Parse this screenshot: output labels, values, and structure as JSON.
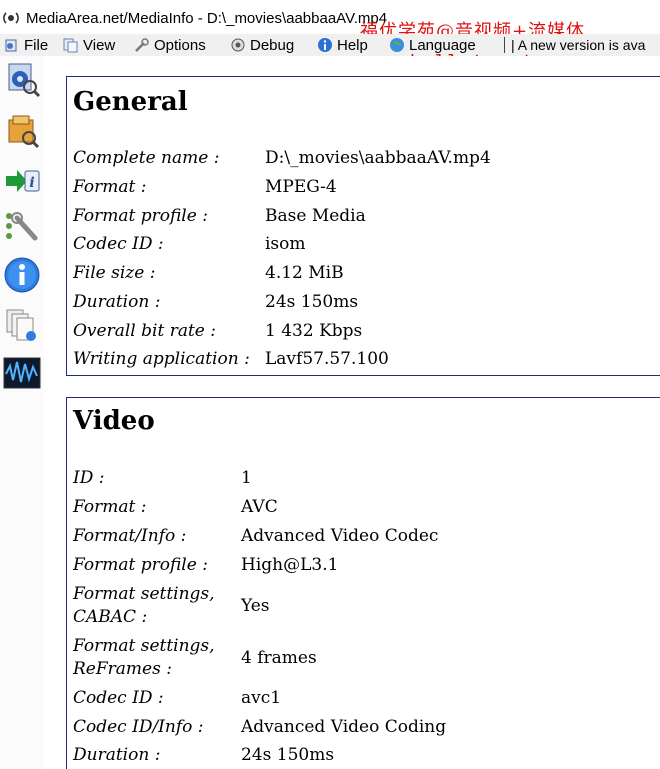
{
  "window": {
    "title": "MediaArea.net/MediaInfo - D:\\_movies\\aabbaaAV.mp4"
  },
  "menu": {
    "file": "File",
    "view": "View",
    "options": "Options",
    "debug": "Debug",
    "help": "Help",
    "language": "Language",
    "notice": "| A new version is ava"
  },
  "watermark": {
    "chinese": "福优学苑@音视频+流媒体",
    "url": "www.hellotongtong.com"
  },
  "sidebar": {
    "icons": [
      "easy-view-icon",
      "sheet-view-icon",
      "export-icon",
      "preferences-icon",
      "about-icon",
      "file-list-icon",
      "waveform-icon"
    ]
  },
  "general": {
    "heading": "General",
    "rows": [
      {
        "label": "Complete name :",
        "value": "D:\\_movies\\aabbaaAV.mp4"
      },
      {
        "label": "Format :",
        "value": "MPEG-4"
      },
      {
        "label": "Format profile :",
        "value": "Base Media"
      },
      {
        "label": "Codec ID :",
        "value": "isom"
      },
      {
        "label": "File size :",
        "value": "4.12 MiB"
      },
      {
        "label": "Duration :",
        "value": "24s 150ms"
      },
      {
        "label": "Overall bit rate :",
        "value": "1 432 Kbps"
      },
      {
        "label": "Writing application :",
        "value": "Lavf57.57.100"
      }
    ]
  },
  "video": {
    "heading": "Video",
    "rows": [
      {
        "label": "ID :",
        "value": "1"
      },
      {
        "label": "Format :",
        "value": "AVC"
      },
      {
        "label": "Format/Info :",
        "value": "Advanced Video Codec"
      },
      {
        "label": "Format profile :",
        "value": "High@L3.1"
      },
      {
        "label_line1": "Format settings,",
        "label_line2": "CABAC :",
        "value": "Yes"
      },
      {
        "label_line1": "Format settings,",
        "label_line2": "ReFrames :",
        "value": "4 frames"
      },
      {
        "label": "Codec ID :",
        "value": "avc1"
      },
      {
        "label": "Codec ID/Info :",
        "value": "Advanced Video Coding"
      },
      {
        "label": "Duration :",
        "value": "24s 150ms"
      }
    ]
  },
  "colors": {
    "section_border": "#1f2a80",
    "watermark": "#e01010",
    "menubar_bg": "#f0f0f0"
  }
}
